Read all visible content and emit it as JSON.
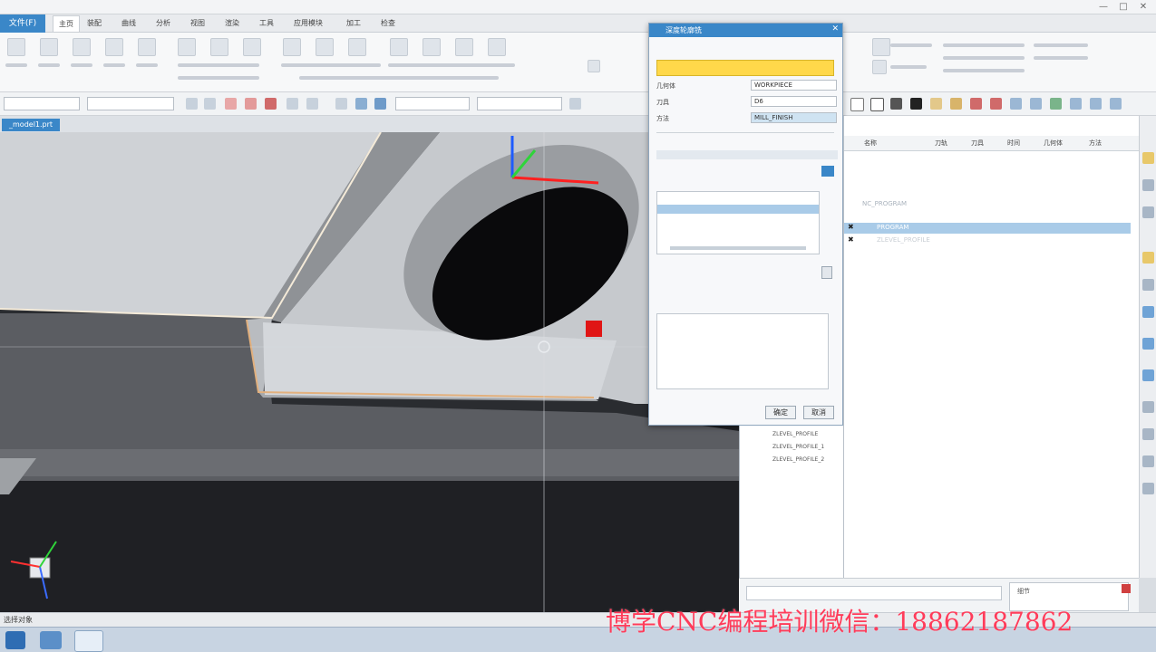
{
  "app": {
    "file_tab": "文件(F)",
    "tabs": [
      "主页",
      "装配",
      "曲线",
      "分析",
      "视图",
      "渲染",
      "工具",
      "应用模块",
      "加工",
      "检查"
    ],
    "document_tab": "_model1.prt",
    "statusbar_left": "选择对象"
  },
  "dialog": {
    "title": "深度轮廓铣",
    "rows": [
      {
        "label": "几何体",
        "value": "WORKPIECE"
      },
      {
        "label": "刀具",
        "value": "D6"
      },
      {
        "label": "方法",
        "value": "MILL_FINISH"
      }
    ],
    "ok": "确定",
    "cancel": "取消"
  },
  "navigator": {
    "columns": [
      "名称",
      "刀轨",
      "刀具",
      "时间",
      "几何体",
      "方法"
    ],
    "rows": [
      {
        "name": "NC_PROGRAM",
        "selected": false
      },
      {
        "name": "PROGRAM",
        "selected": true
      },
      {
        "name": "ZLEVEL_PROFILE",
        "selected": false
      }
    ]
  },
  "bottom_panel": {
    "items": [
      "ZLEVEL_PROFILE",
      "ZLEVEL_PROFILE_1",
      "ZLEVEL_PROFILE_2"
    ],
    "label": "细节"
  },
  "watermark": "博学CNC编程培训微信：18862187862",
  "colors": {
    "accent": "#3a87c8",
    "highlight_row": "#a9cbe8",
    "watermark": "#ff3c5a"
  }
}
